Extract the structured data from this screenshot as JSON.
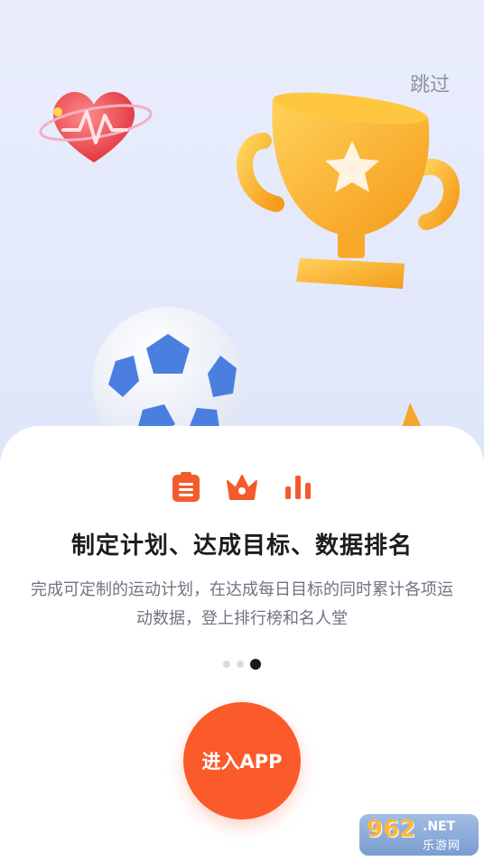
{
  "skip_label": "跳过",
  "features": {
    "icons": [
      "clipboard-icon",
      "crown-icon",
      "bar-chart-icon"
    ],
    "accent_color": "#f45b2c"
  },
  "intro": {
    "title": "制定计划、达成目标、数据排名",
    "description": "完成可定制的运动计划，在达成每日目标的同时累计各项运动数据，登上排行榜和名人堂"
  },
  "pager": {
    "total": 3,
    "active_index": 2
  },
  "enter_button": {
    "label": "进入APP",
    "color": "#fb5a2b"
  },
  "watermark": {
    "number": "962",
    "domain": ".NET",
    "text": "乐游网"
  },
  "illustrations": [
    "heart-rate-icon",
    "trophy-icon",
    "soccer-ball-icon",
    "cone-icon"
  ]
}
